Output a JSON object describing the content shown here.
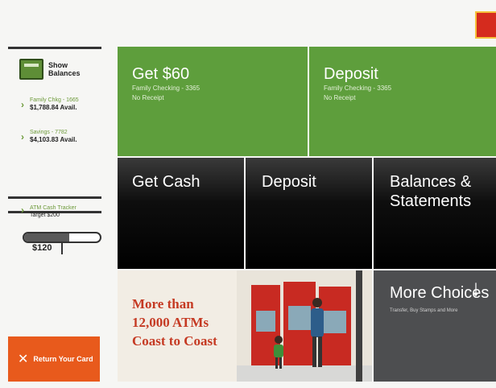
{
  "sidebar": {
    "show_balances": "Show Balances",
    "accounts": [
      {
        "name": "Family Chkg - 1665",
        "balance": "$1,788.84 Avail."
      },
      {
        "name": "Savings - 7782",
        "balance": "$4,103.83 Avail."
      }
    ],
    "target": {
      "name": "ATM Cash Tracker",
      "sub": "Target $200",
      "progress_fraction": 0.6,
      "amount": "$120"
    },
    "return_card": "Return Your Card"
  },
  "tiles": {
    "fast_cash": {
      "title": "Get $60",
      "line1": "Family Checking - 3365",
      "line2": "No Receipt"
    },
    "fast_deposit": {
      "title": "Deposit",
      "line1": "Family Checking - 3365",
      "line2": "No Receipt"
    },
    "get_cash": "Get Cash",
    "deposit": "Deposit",
    "balances": "Balances & Statements",
    "more": {
      "title": "More Choices",
      "desc": "Transfer, Buy Stamps and More"
    }
  },
  "promo": {
    "line1": "More than",
    "line2": "12,000 ATMs",
    "line3": "Coast to Coast"
  },
  "colors": {
    "green": "#5e9e3c",
    "accent_orange": "#e85a1c",
    "promo_red": "#c53a23",
    "brand_red": "#d52b1e"
  },
  "icons": [
    "cash-icon",
    "chevron-right-icon",
    "close-icon",
    "arrow-down-icon"
  ]
}
